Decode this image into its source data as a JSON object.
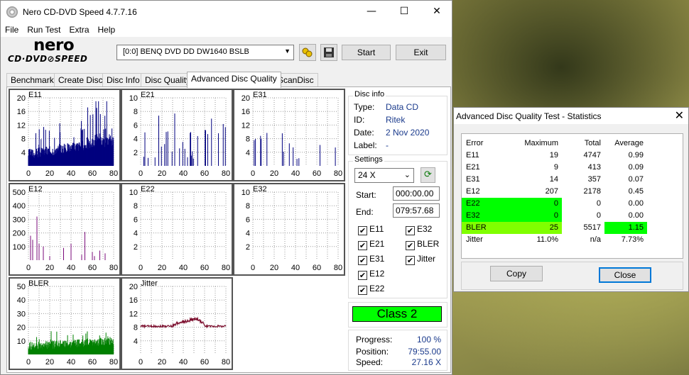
{
  "window": {
    "title": "Nero CD-DVD Speed 4.7.7.16",
    "minimize": "—",
    "maximize": "☐",
    "close": "✕"
  },
  "menu": [
    "File",
    "Run Test",
    "Extra",
    "Help"
  ],
  "logo": {
    "name": "nero",
    "sub": "CD·DVD⊘SPEED"
  },
  "drive": {
    "value": "[0:0]   BENQ DVD DD DW1640 BSLB"
  },
  "buttons": {
    "start": "Start",
    "exit": "Exit"
  },
  "tabs": [
    "Benchmark",
    "Create Disc",
    "Disc Info",
    "Disc Quality",
    "Advanced Disc Quality",
    "ScanDisc"
  ],
  "active_tab": "Advanced Disc Quality",
  "disc_info": {
    "group": "Disc info",
    "type_label": "Type:",
    "type": "Data CD",
    "id_label": "ID:",
    "id": "Ritek",
    "date_label": "Date:",
    "date": "2 Nov 2020",
    "label_label": "Label:",
    "label": "-"
  },
  "settings": {
    "group": "Settings",
    "speed": "24 X",
    "start_label": "Start:",
    "start": "000:00.00",
    "end_label": "End:",
    "end": "079:57.68",
    "checks": {
      "E11": "E11",
      "E32": "E32",
      "E21": "E21",
      "BLER": "BLER",
      "E31": "E31",
      "Jitter": "Jitter",
      "E12": "E12",
      "E22": "E22"
    }
  },
  "class": "Class 2",
  "progress": {
    "progress_label": "Progress:",
    "progress": "100 %",
    "position_label": "Position:",
    "position": "79:55.00",
    "speed_label": "Speed:",
    "speed": "27.16 X"
  },
  "colors": {
    "accent_green": "#00ff00",
    "lime": "#80ff00",
    "navy_plot": "#00007f",
    "purple_plot": "#7a0a7a",
    "green_plot": "#008000",
    "jitter_plot": "#7a0a2a"
  },
  "graphs": [
    {
      "name": "E11",
      "ymax": 20,
      "yticks": [
        20,
        16,
        12,
        8,
        4
      ],
      "color": "#00007f",
      "kind": "dense"
    },
    {
      "name": "E21",
      "ymax": 10,
      "yticks": [
        10,
        8,
        6,
        4,
        2
      ],
      "color": "#00007f",
      "kind": "sparse"
    },
    {
      "name": "E31",
      "ymax": 20,
      "yticks": [
        20,
        16,
        12,
        8,
        4
      ],
      "color": "#00007f",
      "kind": "sparse2"
    },
    {
      "name": "E12",
      "ymax": 500,
      "yticks": [
        500,
        400,
        300,
        200,
        100
      ],
      "color": "#7a0a7a",
      "kind": "spikes"
    },
    {
      "name": "E22",
      "ymax": 10,
      "yticks": [
        10,
        8,
        6,
        4,
        2
      ],
      "color": "#7a0a7a",
      "kind": "empty"
    },
    {
      "name": "E32",
      "ymax": 10,
      "yticks": [
        10,
        8,
        6,
        4,
        2
      ],
      "color": "#7a0a7a",
      "kind": "empty"
    },
    {
      "name": "BLER",
      "ymax": 50,
      "yticks": [
        50,
        40,
        30,
        20,
        10
      ],
      "color": "#008000",
      "kind": "bler"
    },
    {
      "name": "Jitter",
      "ymax": 20,
      "yticks": [
        20,
        16,
        12,
        8,
        4
      ],
      "color": "#7a0a2a",
      "kind": "jitter"
    }
  ],
  "xticks": [
    "0",
    "20",
    "40",
    "60",
    "80"
  ],
  "stats": {
    "title": "Advanced Disc Quality Test - Statistics",
    "close": "✕",
    "headers": {
      "error": "Error",
      "maximum": "Maximum",
      "total": "Total",
      "average": "Average"
    },
    "rows": [
      {
        "error": "E11",
        "maximum": "19",
        "total": "4747",
        "average": "0.99"
      },
      {
        "error": "E21",
        "maximum": "9",
        "total": "413",
        "average": "0.09"
      },
      {
        "error": "E31",
        "maximum": "14",
        "total": "357",
        "average": "0.07"
      },
      {
        "error": "E12",
        "maximum": "207",
        "total": "2178",
        "average": "0.45"
      },
      {
        "error": "E22",
        "maximum": "0",
        "total": "0",
        "average": "0.00"
      },
      {
        "error": "E32",
        "maximum": "0",
        "total": "0",
        "average": "0.00"
      },
      {
        "error": "BLER",
        "maximum": "25",
        "total": "5517",
        "average": "1.15"
      },
      {
        "error": "Jitter",
        "maximum": "11.0%",
        "total": "n/a",
        "average": "7.73%"
      }
    ],
    "copy": "Copy",
    "close_btn": "Close"
  }
}
